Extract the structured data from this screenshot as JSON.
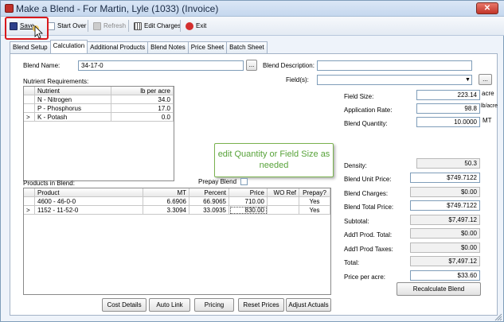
{
  "window": {
    "title": "Make a Blend - For Martin, Lyle (1033) (Invoice)",
    "close_glyph": "✕"
  },
  "toolbar": {
    "save": "Save",
    "start_over": "Start Over",
    "refresh": "Refresh",
    "edit_charges": "Edit Charges",
    "exit": "Exit"
  },
  "tabs": [
    "Blend Setup",
    "Calculation",
    "Additional Products",
    "Blend Notes",
    "Price Sheet",
    "Batch Sheet"
  ],
  "active_tab": "Calculation",
  "blend": {
    "name_label": "Blend Name:",
    "name_value": "34-17-0",
    "browse": "...",
    "desc_label": "Blend Description:",
    "desc_value": "",
    "fields_label": "Field(s):",
    "fields_value": "",
    "fields_browse": "..."
  },
  "nutrients": {
    "section_label": "Nutrient Requirements:",
    "headers": [
      "Nutrient",
      "lb per acre"
    ],
    "rows": [
      {
        "marker": "",
        "name": "N - Nitrogen",
        "value": "34.0"
      },
      {
        "marker": "",
        "name": "P - Phosphorus",
        "value": "17.0"
      },
      {
        "marker": ">",
        "name": "K - Potash",
        "value": "0.0"
      }
    ]
  },
  "callout": "edit Quantity or Field Size as needed",
  "right": {
    "field_size_label": "Field Size:",
    "field_size_value": "223.14",
    "field_size_unit": "acre",
    "app_rate_label": "Application Rate:",
    "app_rate_value": "98.8",
    "app_rate_unit": "lb/acre",
    "blend_qty_label": "Blend Quantity:",
    "blend_qty_value": "10.0000",
    "blend_qty_unit": "MT",
    "density_label": "Density:",
    "density_value": "50.3",
    "unit_price_label": "Blend Unit Price:",
    "unit_price_value": "$749.7122",
    "charges_label": "Blend Charges:",
    "charges_value": "$0.00",
    "total_price_label": "Blend Total Price:",
    "total_price_value": "$749.7122",
    "subtotal_label": "Subtotal:",
    "subtotal_value": "$7,497.12",
    "addl_total_label": "Add'l Prod. Total:",
    "addl_total_value": "$0.00",
    "addl_taxes_label": "Add'l Prod Taxes:",
    "addl_taxes_value": "$0.00",
    "total_label": "Total:",
    "total_value": "$7,497.12",
    "per_acre_label": "Price per acre:",
    "per_acre_value": "$33.60",
    "recalc": "Recalculate Blend"
  },
  "products": {
    "section_label": "Products in Blend:",
    "prepay_label": "Prepay Blend",
    "headers": [
      "Product",
      "MT",
      "Percent",
      "Price",
      "WO Ref",
      "Prepay?"
    ],
    "rows": [
      {
        "marker": "",
        "product": "4600 - 46-0-0",
        "mt": "6.6906",
        "percent": "66.9065",
        "price": "710.00",
        "wo": "",
        "prepay": "Yes"
      },
      {
        "marker": ">",
        "product": "1152 - 11-52-0",
        "mt": "3.3094",
        "percent": "33.0935",
        "price": "830.00",
        "wo": "",
        "prepay": "Yes"
      }
    ]
  },
  "bottom": {
    "cost_details": "Cost Details",
    "auto_link": "Auto Link",
    "pricing": "Pricing",
    "reset_prices": "Reset Prices",
    "adjust_actuals": "Adjust Actuals"
  },
  "colors": {
    "accent_red": "#d8181c",
    "callout_green": "#58a33a"
  }
}
